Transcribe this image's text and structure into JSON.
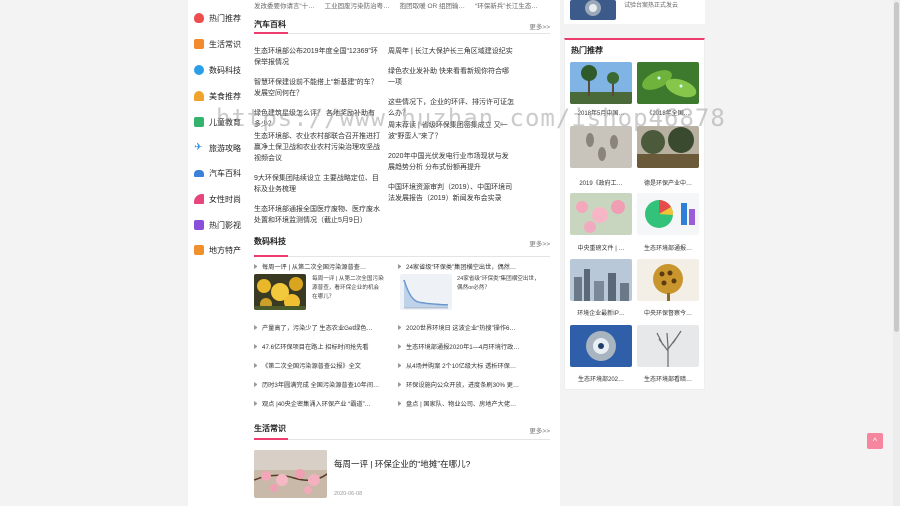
{
  "colors": {
    "accent": "#ee3d6c",
    "back_top": "#f6859e"
  },
  "top_strip": [
    "发改委要你请言“十…",
    "工业固废污染防治粤…",
    "抱团取暖 OR 组团输…",
    "“环保新兵”长江生态…"
  ],
  "sidebar": {
    "items": [
      {
        "label": "热门推荐",
        "icon": "fire-icon",
        "color": "#ee4d4d"
      },
      {
        "label": "生活常识",
        "icon": "life-icon",
        "color": "#f28a2e"
      },
      {
        "label": "数码科技",
        "icon": "digital-icon",
        "color": "#2b9ee8"
      },
      {
        "label": "美食推荐",
        "icon": "food-icon",
        "color": "#f0a32c"
      },
      {
        "label": "儿童教育",
        "icon": "education-icon",
        "color": "#33b36b"
      },
      {
        "label": "旅游攻略",
        "icon": "plane-icon",
        "color": "#2f8fe0"
      },
      {
        "label": "汽车百科",
        "icon": "car-icon",
        "color": "#3a7fd8"
      },
      {
        "label": "女性时尚",
        "icon": "heels-icon",
        "color": "#e8457a"
      },
      {
        "label": "热门影视",
        "icon": "video-icon",
        "color": "#8a4fd8"
      },
      {
        "label": "地方特产",
        "icon": "gift-icon",
        "color": "#f0902c"
      }
    ]
  },
  "auto_section": {
    "title": "汽车百科",
    "more": "更多>>",
    "left": [
      "生态环境部公布2019年度全国“12369”环保举报情况",
      "智慧环保建设前不能搭上“新基建”的车？ 发展空间何在？",
      "绿色建筑星级怎么评？ 各地奖励补助有多少？",
      "生态环境部、农业农村部联合召开推进打赢净土保卫战和农业农村污染治理攻坚战视频会议",
      "9大环保集团陆续设立 主要战略定位、目标及业务梳理",
      "生态环境部通报全国医疗废物、医疗废水处置和环境监测情况（截止5月9日）"
    ],
    "right": [
      "周周年 | 长江大保护长三角区域建设纪实",
      "绿色农业发补助 快来看看新规你符合哪一项",
      "这些情况下，企业的环评、排污许可证怎么办？",
      "周末荐读 | 省级环保集团密集成立 又一波“野蛮人”来了？",
      "2020年中国光伏发电行业市场现状与发展趋势分析 分布式份额再提升",
      "中国环境资源审判（2019）、中国环境司法发展报告（2019）新闻发布会实录"
    ]
  },
  "digital_section": {
    "title": "数码科技",
    "more": "更多>>",
    "featured_left": {
      "headline": "每周一评 | 从第二次全国污染源普查…",
      "caption": "每周一评 | 从第二次全国污染源普查，看环保企业的机会在哪儿？"
    },
    "featured_right": {
      "headline": "24家省级“环保类”集团横空出世，偶然…",
      "caption": "24家省级“环保类”集团横空出世，偶然or必然？"
    },
    "left_list": [
      "产量高了，污染少了 生态农业Get绿色…",
      "47.6亿环保项目在路上 招标时间抢先看",
      "《第二次全国污染源普查公报》全文",
      "历时3年圆满完成 全国污染源普查10年间…",
      "观点 |40央企密集涌入环保产业 “霸道”…"
    ],
    "right_list": [
      "2020世界环境日 这波企业“热搜”操作6…",
      "生态环境部通报2020年1—4月环境行政…",
      "从4场并购案 2个10亿级大标 透析环保…",
      "环保设施向公众开放，进度条刷30% 更…",
      "盘点 | 国家队、物业公司、房地产大佬…"
    ]
  },
  "life_section": {
    "title": "生活常识",
    "more": "更多>>",
    "article_title": "每周一评 | 环保企业的“地摊”在哪儿?",
    "article_date": "2020-06-08"
  },
  "right_top_caption": "试验台案热正式发云",
  "hot_panel": {
    "title": "热门推荐",
    "items": [
      {
        "caption": "2018年5月中国…",
        "thumb": "palm-tree-thumb"
      },
      {
        "caption": "《2018年全国…",
        "thumb": "leaf-thumb"
      },
      {
        "caption": "2019《政府工…",
        "thumb": "footprints-thumb"
      },
      {
        "caption": "德是环保产业中…",
        "thumb": "trees-thumb"
      },
      {
        "caption": "中央重磅文件 | …",
        "thumb": "blossom-thumb"
      },
      {
        "caption": "生态环境部通报…",
        "thumb": "chart-thumb"
      },
      {
        "caption": "环境企业最新IP…",
        "thumb": "city-thumb"
      },
      {
        "caption": "中央环保督察今…",
        "thumb": "lotus-thumb"
      },
      {
        "caption": "生态环境部202…",
        "thumb": "pipe-thumb"
      },
      {
        "caption": "生态环境部看暗…",
        "thumb": "bare-tree-thumb"
      }
    ]
  },
  "watermark": "https://www.huzhan.com/ishop46878",
  "back_to_top": "^"
}
